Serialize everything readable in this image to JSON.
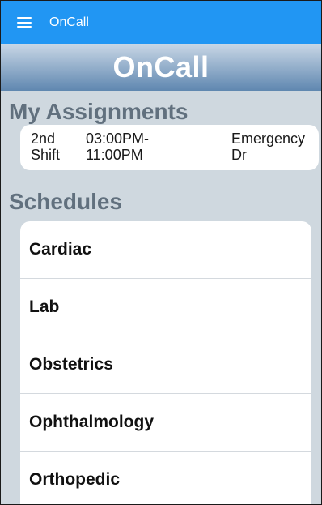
{
  "app_bar": {
    "title": "OnCall",
    "menu_icon": "hamburger-menu-icon"
  },
  "header": {
    "title": "OnCall"
  },
  "assignments": {
    "title": "My Assignments",
    "items": [
      {
        "shift": [
          "2nd",
          "Shift"
        ],
        "time": [
          "03:00PM-",
          "11:00PM"
        ],
        "department": [
          "Emergency",
          "Dr"
        ]
      }
    ]
  },
  "schedules": {
    "title": "Schedules",
    "items": [
      {
        "label": "Cardiac"
      },
      {
        "label": "Lab"
      },
      {
        "label": "Obstetrics"
      },
      {
        "label": "Ophthalmology"
      },
      {
        "label": "Orthopedic"
      }
    ]
  },
  "colors": {
    "app_bar": "#2196f3",
    "background": "#cfd8df",
    "section_title": "#61707e",
    "header_gradient_top": "#c9d7e6",
    "header_gradient_bottom": "#5f87b0"
  }
}
